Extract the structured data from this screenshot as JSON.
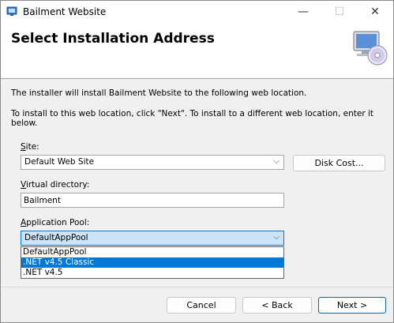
{
  "window": {
    "title": "Bailment Website"
  },
  "titlebar": {
    "minimize": "—",
    "maximize": "☐",
    "close": "✕"
  },
  "header": {
    "title": "Select Installation Address"
  },
  "intro": {
    "line1": "The installer will install Bailment Website to the following web location.",
    "line2": "To install to this web location, click \"Next\". To install to a different web location, enter it below."
  },
  "site": {
    "label_first": "S",
    "label_rest": "ite:",
    "value": "Default Web Site",
    "disk_cost": "Disk Cost..."
  },
  "virtual_directory": {
    "label_first": "V",
    "label_rest": "irtual directory:",
    "value": "Bailment"
  },
  "app_pool": {
    "label_first": "A",
    "label_rest": "pplication Pool:",
    "value": "DefaultAppPool",
    "options": [
      "DefaultAppPool",
      ".NET v4.5 Classic",
      ".NET v4.5"
    ],
    "highlighted_index": 1
  },
  "buttons": {
    "cancel": "Cancel",
    "back": "< Back",
    "next": "Next >"
  },
  "icons": {
    "app": "installer-icon",
    "header": "computer-cd-icon",
    "arrow": "chevron-down-icon"
  }
}
